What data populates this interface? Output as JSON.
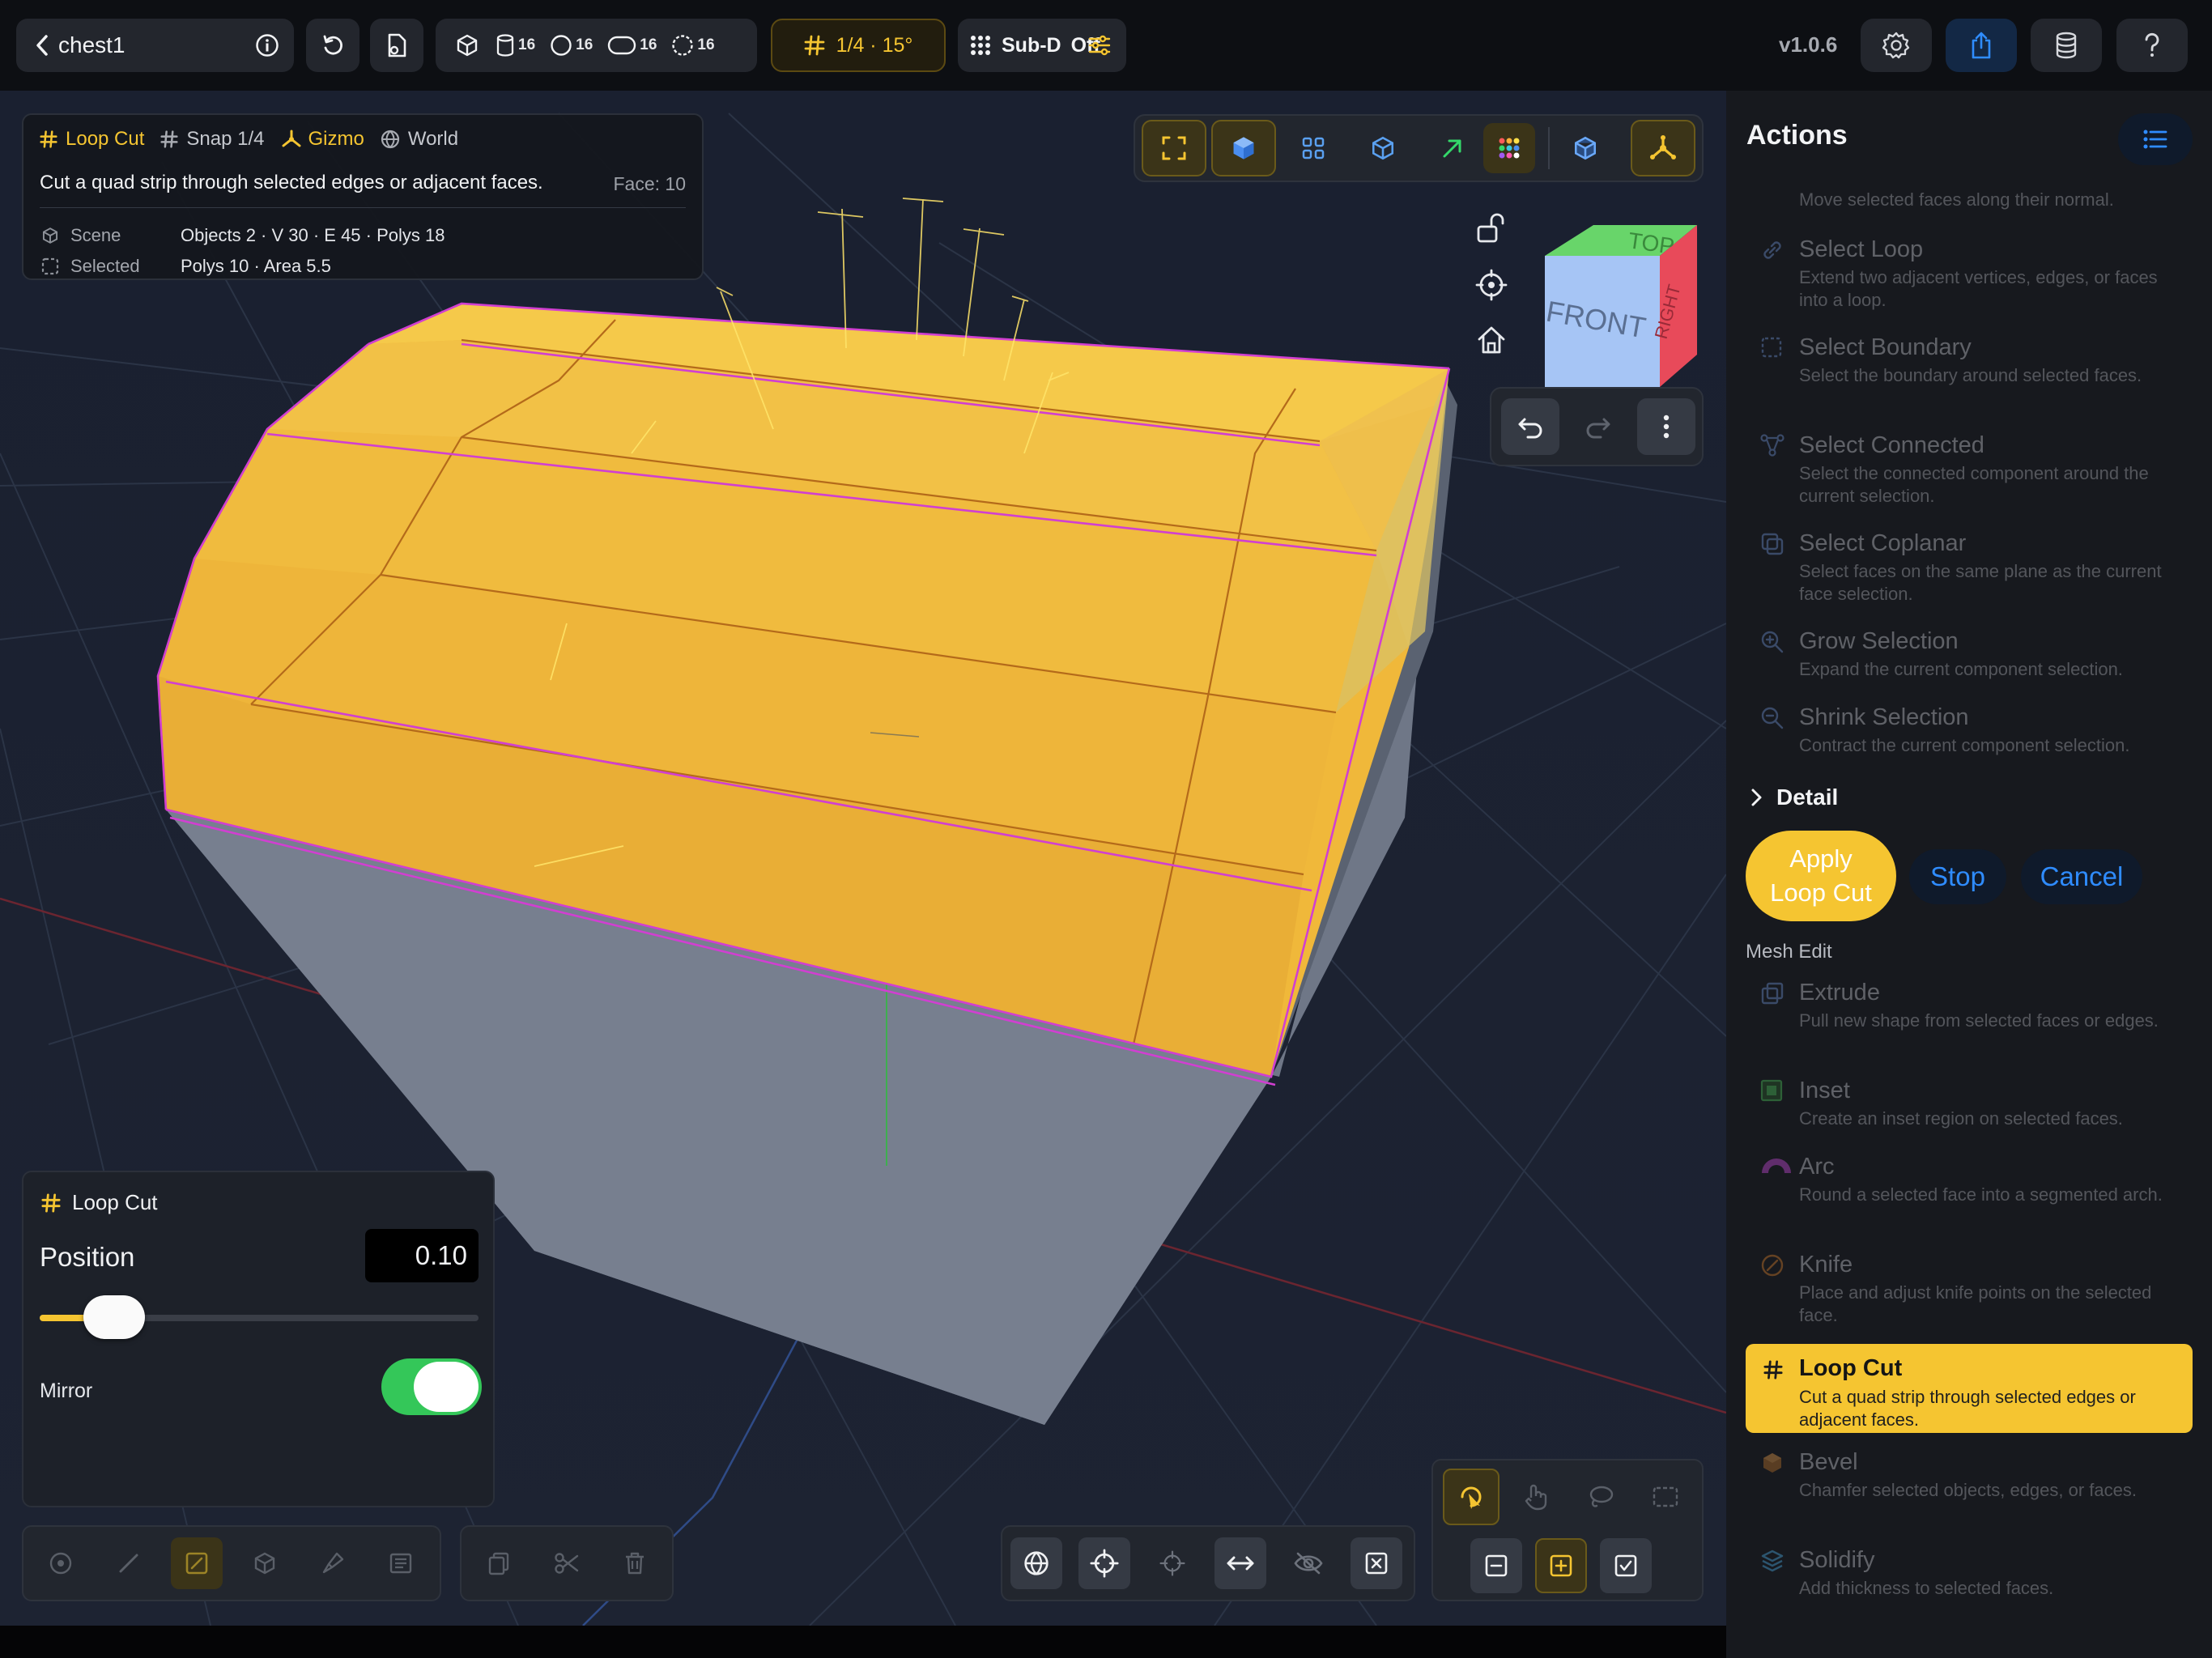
{
  "header": {
    "file_name": "chest1",
    "counts": [
      "16",
      "16",
      "16",
      "16"
    ],
    "snap_label": "1/4 · 15°",
    "subd_label": "Sub-D",
    "subd_state": "Off",
    "version": "v1.0.6"
  },
  "info": {
    "mode": "Loop Cut",
    "snap": "Snap 1/4",
    "gizmo": "Gizmo",
    "space": "World",
    "description": "Cut a quad strip through selected edges or adjacent faces.",
    "face_label": "Face: 10",
    "scene_label": "Scene",
    "scene_value": "Objects 2 · V 30 · E 45 · Polys 18",
    "selected_label": "Selected",
    "selected_value": "Polys 10 · Area 5.5"
  },
  "navcube": {
    "top": "TOP",
    "front": "FRONT",
    "right": "RIGHT"
  },
  "tool_panel": {
    "title": "Loop Cut",
    "position_label": "Position",
    "position_value": "0.10",
    "slider_fraction": 0.1,
    "mirror_label": "Mirror",
    "mirror_on": true
  },
  "sidebar": {
    "title": "Actions",
    "partial_desc": "Move selected faces along their normal.",
    "items": [
      {
        "title": "Select Loop",
        "desc": "Extend two adjacent vertices, edges, or faces into a loop.",
        "icon": "loop-icon"
      },
      {
        "title": "Select Boundary",
        "desc": "Select the boundary around selected faces.",
        "icon": "boundary-icon"
      },
      {
        "title": "Select Connected",
        "desc": "Select the connected component around the current selection.",
        "icon": "connected-icon"
      },
      {
        "title": "Select Coplanar",
        "desc": "Select faces on the same plane as the current face selection.",
        "icon": "coplanar-icon"
      },
      {
        "title": "Grow Selection",
        "desc": "Expand the current component selection.",
        "icon": "grow-icon"
      },
      {
        "title": "Shrink Selection",
        "desc": "Contract the current component selection.",
        "icon": "shrink-icon"
      }
    ],
    "detail_label": "Detail",
    "apply_line1": "Apply",
    "apply_line2": "Loop Cut",
    "stop_label": "Stop",
    "cancel_label": "Cancel",
    "section_label": "Mesh Edit",
    "mesh_items": [
      {
        "title": "Extrude",
        "desc": "Pull new shape from selected faces or edges.",
        "icon": "extrude-icon"
      },
      {
        "title": "Inset",
        "desc": "Create an inset region on selected faces.",
        "icon": "inset-icon"
      },
      {
        "title": "Arc",
        "desc": "Round a selected face into a segmented arch.",
        "icon": "arc-icon"
      },
      {
        "title": "Knife",
        "desc": "Place and adjust knife points on the selected face.",
        "icon": "knife-icon"
      },
      {
        "title": "Loop Cut",
        "desc": "Cut a quad strip through selected edges or adjacent faces.",
        "icon": "loop-cut-icon",
        "active": true
      },
      {
        "title": "Bevel",
        "desc": "Chamfer selected objects, edges, or faces.",
        "icon": "bevel-icon"
      },
      {
        "title": "Solidify",
        "desc": "Add thickness to selected faces.",
        "icon": "solidify-icon"
      }
    ]
  },
  "colors": {
    "accent": "#f5c531",
    "blue": "#2f8cff",
    "green": "#34c759",
    "panel": "#23262d"
  }
}
